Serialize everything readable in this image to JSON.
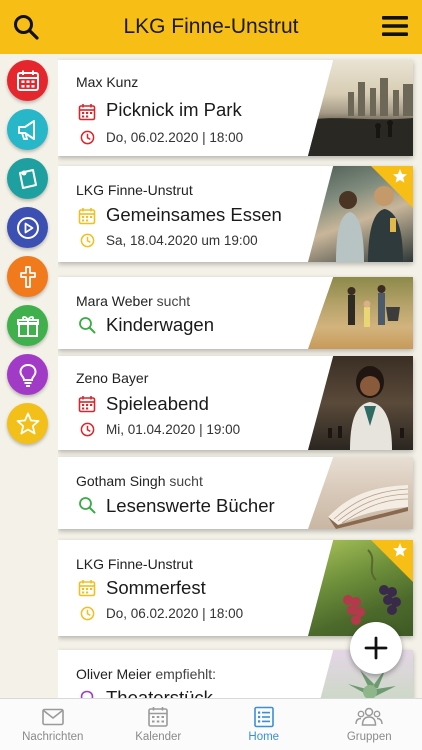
{
  "header": {
    "title": "LKG Finne-Unstrut"
  },
  "rail": [
    {
      "name": "calendar",
      "color": "#e6262d"
    },
    {
      "name": "megaphone",
      "color": "#28b6c9"
    },
    {
      "name": "pin-note",
      "color": "#1ea0a0"
    },
    {
      "name": "play",
      "color": "#3c4fb3"
    },
    {
      "name": "cross",
      "color": "#f07a1c"
    },
    {
      "name": "gift",
      "color": "#3fb04b"
    },
    {
      "name": "lightbulb",
      "color": "#a13bc7"
    },
    {
      "name": "star",
      "color": "#f3c019"
    }
  ],
  "cards": [
    {
      "author": "Max Kunz",
      "verb": "",
      "title": "Picknick im Park",
      "date": "Do, 06.02.2020 | 18:00",
      "type": "event",
      "accent": "#d9252b",
      "starred": false
    },
    {
      "author": "LKG Finne-Unstrut",
      "verb": "",
      "title": "Gemeinsames Essen",
      "date": "Sa, 18.04.2020 um 19:00",
      "type": "event",
      "accent": "#f2bf1e",
      "starred": true
    },
    {
      "author": "Mara Weber",
      "verb": "sucht",
      "title": "Kinderwagen",
      "date": "",
      "type": "search",
      "accent": "#3aac46",
      "starred": false
    },
    {
      "author": "Zeno Bayer",
      "verb": "",
      "title": "Spieleabend",
      "date": "Mi, 01.04.2020 | 19:00",
      "type": "event",
      "accent": "#d9252b",
      "starred": false
    },
    {
      "author": "Gotham Singh",
      "verb": "sucht",
      "title": "Lesenswerte Bücher",
      "date": "",
      "type": "search",
      "accent": "#3aac46",
      "starred": false
    },
    {
      "author": "LKG Finne-Unstrut",
      "verb": "",
      "title": "Sommerfest",
      "date": "Do, 06.02.2020 | 18:00",
      "type": "event",
      "accent": "#f2bf1e",
      "starred": true
    },
    {
      "author": "Oliver Meier",
      "verb": "empfiehlt:",
      "title": "Theaterstück",
      "date": "",
      "type": "recommend",
      "accent": "#a13bc7",
      "starred": false
    }
  ],
  "nav": [
    {
      "label": "Nachrichten",
      "icon": "envelope-icon",
      "active": false
    },
    {
      "label": "Kalender",
      "icon": "calendar-icon",
      "active": false
    },
    {
      "label": "Home",
      "icon": "list-icon",
      "active": true
    },
    {
      "label": "Gruppen",
      "icon": "group-icon",
      "active": false
    }
  ],
  "colors": {
    "brand": "#f7be15",
    "active": "#3a8fd9"
  }
}
